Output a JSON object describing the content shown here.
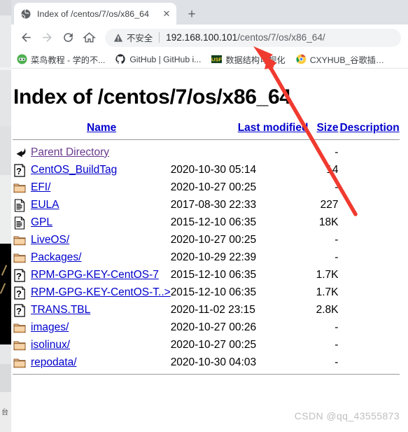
{
  "window": {
    "tab": {
      "title": "Index of /centos/7/os/x86_64",
      "favicon": "globe-icon",
      "close_label": "✕"
    },
    "new_tab_label": "+",
    "toolbar": {
      "back_icon": "arrow-left-icon",
      "forward_icon": "arrow-right-icon",
      "reload_icon": "reload-icon",
      "home_icon": "home-icon",
      "security_icon": "warning-triangle-icon",
      "security_label": "不安全",
      "url_host": "192.168.100.101",
      "url_path": "/centos/7/os/x86_64/",
      "url_full": "192.168.100.101/centos/7/os/x86_64/"
    },
    "bookmarks": [
      {
        "label": "菜鸟教程 - 学的不...",
        "icon": "runoob-icon"
      },
      {
        "label": "GitHub | GitHub i...",
        "icon": "github-icon"
      },
      {
        "label": "数据结构可视化",
        "icon": "usf-icon"
      },
      {
        "label": "CXYHUB_谷歌插件...",
        "icon": "chrome-icon"
      }
    ]
  },
  "page": {
    "heading": "Index of /centos/7/os/x86_64",
    "columns": [
      "Name",
      "Last modified",
      "Size",
      "Description"
    ],
    "rows": [
      {
        "icon": "parent-directory-icon",
        "name": "Parent Directory",
        "modified": "",
        "size": "-",
        "description": ""
      },
      {
        "icon": "unknown-file-icon",
        "name": "CentOS_BuildTag",
        "modified": "2020-10-30 05:14",
        "size": "14",
        "description": ""
      },
      {
        "icon": "folder-icon",
        "name": "EFI/",
        "modified": "2020-10-27 00:25",
        "size": "-",
        "description": ""
      },
      {
        "icon": "text-file-icon",
        "name": "EULA",
        "modified": "2017-08-30 22:33",
        "size": "227",
        "description": ""
      },
      {
        "icon": "text-file-icon",
        "name": "GPL",
        "modified": "2015-12-10 06:35",
        "size": "18K",
        "description": ""
      },
      {
        "icon": "folder-icon",
        "name": "LiveOS/",
        "modified": "2020-10-27 00:25",
        "size": "-",
        "description": ""
      },
      {
        "icon": "folder-icon",
        "name": "Packages/",
        "modified": "2020-10-29 22:39",
        "size": "-",
        "description": ""
      },
      {
        "icon": "unknown-file-icon",
        "name": "RPM-GPG-KEY-CentOS-7",
        "modified": "2015-12-10 06:35",
        "size": "1.7K",
        "description": ""
      },
      {
        "icon": "unknown-file-icon",
        "name": "RPM-GPG-KEY-CentOS-T..>",
        "modified": "2015-12-10 06:35",
        "size": "1.7K",
        "description": ""
      },
      {
        "icon": "unknown-file-icon",
        "name": "TRANS.TBL",
        "modified": "2020-11-02 23:15",
        "size": "2.8K",
        "description": ""
      },
      {
        "icon": "folder-icon",
        "name": "images/",
        "modified": "2020-10-27 00:26",
        "size": "-",
        "description": ""
      },
      {
        "icon": "folder-icon",
        "name": "isolinux/",
        "modified": "2020-10-27 00:25",
        "size": "-",
        "description": ""
      },
      {
        "icon": "folder-icon",
        "name": "repodata/",
        "modified": "2020-10-30 04:03",
        "size": "-",
        "description": ""
      }
    ]
  },
  "watermark": "CSDN @qq_43555873",
  "annotation": {
    "type": "arrow",
    "color": "#f03a2f",
    "points_at": "url-bar"
  },
  "colors": {
    "link": "#0000cc",
    "visited_link": "#6a3a8f",
    "tabstrip_bg": "#dee1e6",
    "omnibox_bg": "#f1f3f4",
    "annotation_red": "#f03a2f",
    "watermark_gray": "#bfbfbf"
  }
}
